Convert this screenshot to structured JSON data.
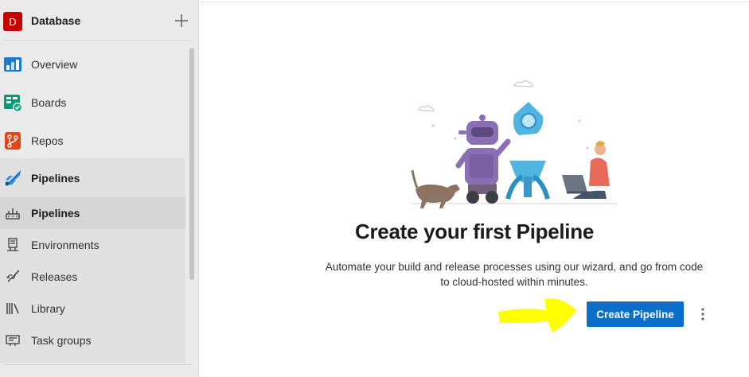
{
  "project": {
    "initial": "D",
    "name": "Database",
    "add_icon": "plus-icon"
  },
  "nav": [
    {
      "label": "Overview",
      "icon": "overview-icon"
    },
    {
      "label": "Boards",
      "icon": "boards-icon"
    },
    {
      "label": "Repos",
      "icon": "repos-icon"
    },
    {
      "label": "Pipelines",
      "icon": "pipelines-icon"
    }
  ],
  "pipelines_sub": [
    {
      "label": "Pipelines",
      "icon": "pipeline-list-icon",
      "selected": true
    },
    {
      "label": "Environments",
      "icon": "environments-icon"
    },
    {
      "label": "Releases",
      "icon": "releases-icon"
    },
    {
      "label": "Library",
      "icon": "library-icon"
    },
    {
      "label": "Task groups",
      "icon": "task-groups-icon"
    }
  ],
  "main": {
    "title": "Create your first Pipeline",
    "description": "Automate your build and release processes using our wizard, and go from code to cloud-hosted within minutes.",
    "create_button": "Create Pipeline",
    "more_icon": "more-vertical-icon"
  },
  "colors": {
    "primary": "#0a6fc9",
    "project_avatar": "#c70000",
    "sidebar_bg": "#eaeaea",
    "annotation_arrow": "#ffff00"
  }
}
